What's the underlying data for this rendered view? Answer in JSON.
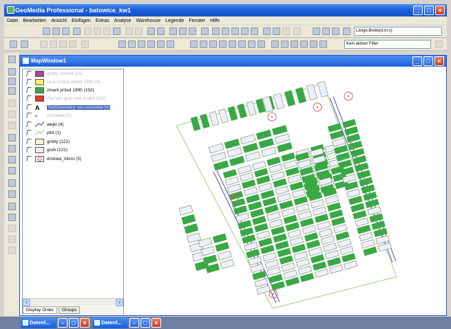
{
  "app": {
    "title": "GeoMedia Professional - batowice_kw1"
  },
  "menu": [
    "Datei",
    "Bearbeiten",
    "Ansicht",
    "Einfügen",
    "Extras",
    "Analyse",
    "Warehouse",
    "Legende",
    "Fenster",
    "Hilfe"
  ],
  "toolbar": {
    "coord_format": "Länge,Breite(d:m:s)",
    "filter": "Kein aktiver Filter"
  },
  "map_window": {
    "title": "MapWindow1"
  },
  "legend": {
    "items": [
      {
        "label": "groby ziemne (15)",
        "swatch": "#a8469b",
        "style": "dim"
      },
      {
        "label": "inna zmarla przed 1990 (4)",
        "swatch": "#f5f06a",
        "style": "dim"
      },
      {
        "label": "zmarli przed 1990 (152)",
        "swatch": "#3aa845",
        "style": "normal"
      },
      {
        "label": "Ziel von grob und zmarli (152)",
        "swatch": "#e23a2a",
        "style": "dim"
      },
      {
        "label": "TextGeometry von cononwa (4)",
        "swatch": "text-a",
        "style": "sel"
      },
      {
        "label": "cononwa (5)",
        "swatch": "point-red",
        "style": "dim"
      },
      {
        "label": "alejki (4)",
        "swatch": "line-green",
        "style": "normal"
      },
      {
        "label": "plot (1)",
        "swatch": "line-lightgreen",
        "style": "normal"
      },
      {
        "label": "groby (121)",
        "swatch": "#fff7cc",
        "style": "normal"
      },
      {
        "label": "grob (121)",
        "swatch": "#eaf1fb",
        "style": "normal"
      },
      {
        "label": "drzewa_micro (5)",
        "swatch": "tree-symbol",
        "style": "normal"
      }
    ]
  },
  "tabs": {
    "display_order": "Display Order",
    "groups": "Groups"
  },
  "taskbar": {
    "items": [
      "Datenf...",
      "Datenf..."
    ]
  },
  "colors": {
    "grave_fill": "#3aa845",
    "grave_outline": "#3aa845",
    "cell_fill": "#eaf1fb",
    "cell_outline": "#8b8f6a",
    "alley": "#4b49a8",
    "plot": "#9dcf7a",
    "tree": "#d86060"
  }
}
